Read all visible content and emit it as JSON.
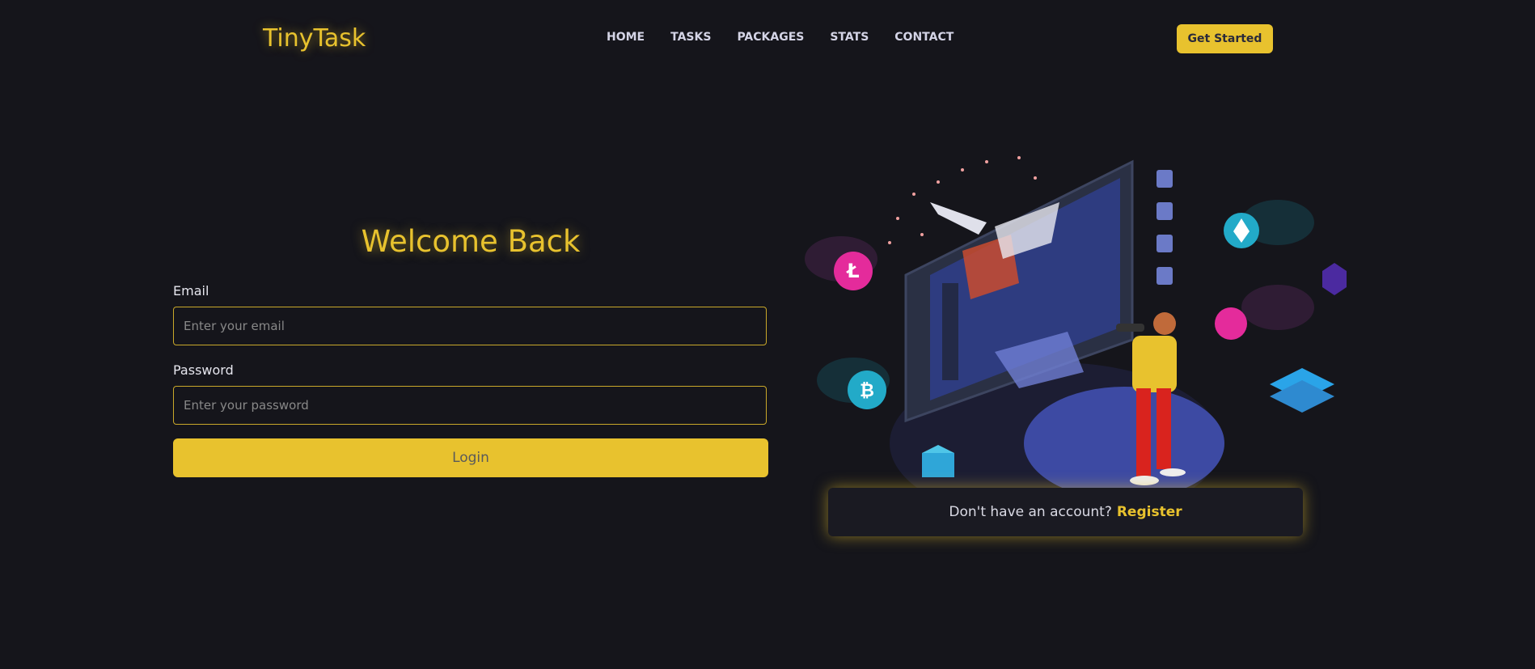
{
  "brand": {
    "logo": "TinyTask",
    "accent": "#e8c22e",
    "background": "#15151b"
  },
  "nav": {
    "items": [
      "HOME",
      "TASKS",
      "PACKAGES",
      "STATS",
      "CONTACT"
    ],
    "cta": "Get Started"
  },
  "login": {
    "title": "Welcome Back",
    "email_label": "Email",
    "email_placeholder": "Enter your email",
    "password_label": "Password",
    "password_placeholder": "Enter your password",
    "submit": "Login"
  },
  "register": {
    "prompt": "Don't have an account?",
    "link": "Register"
  },
  "illustration": {
    "icons": [
      "litecoin-icon",
      "bitcoin-icon",
      "ethereum-icon",
      "ripple-icon",
      "phone-icon",
      "vr-gamer-icon",
      "spaceship-icon"
    ]
  }
}
